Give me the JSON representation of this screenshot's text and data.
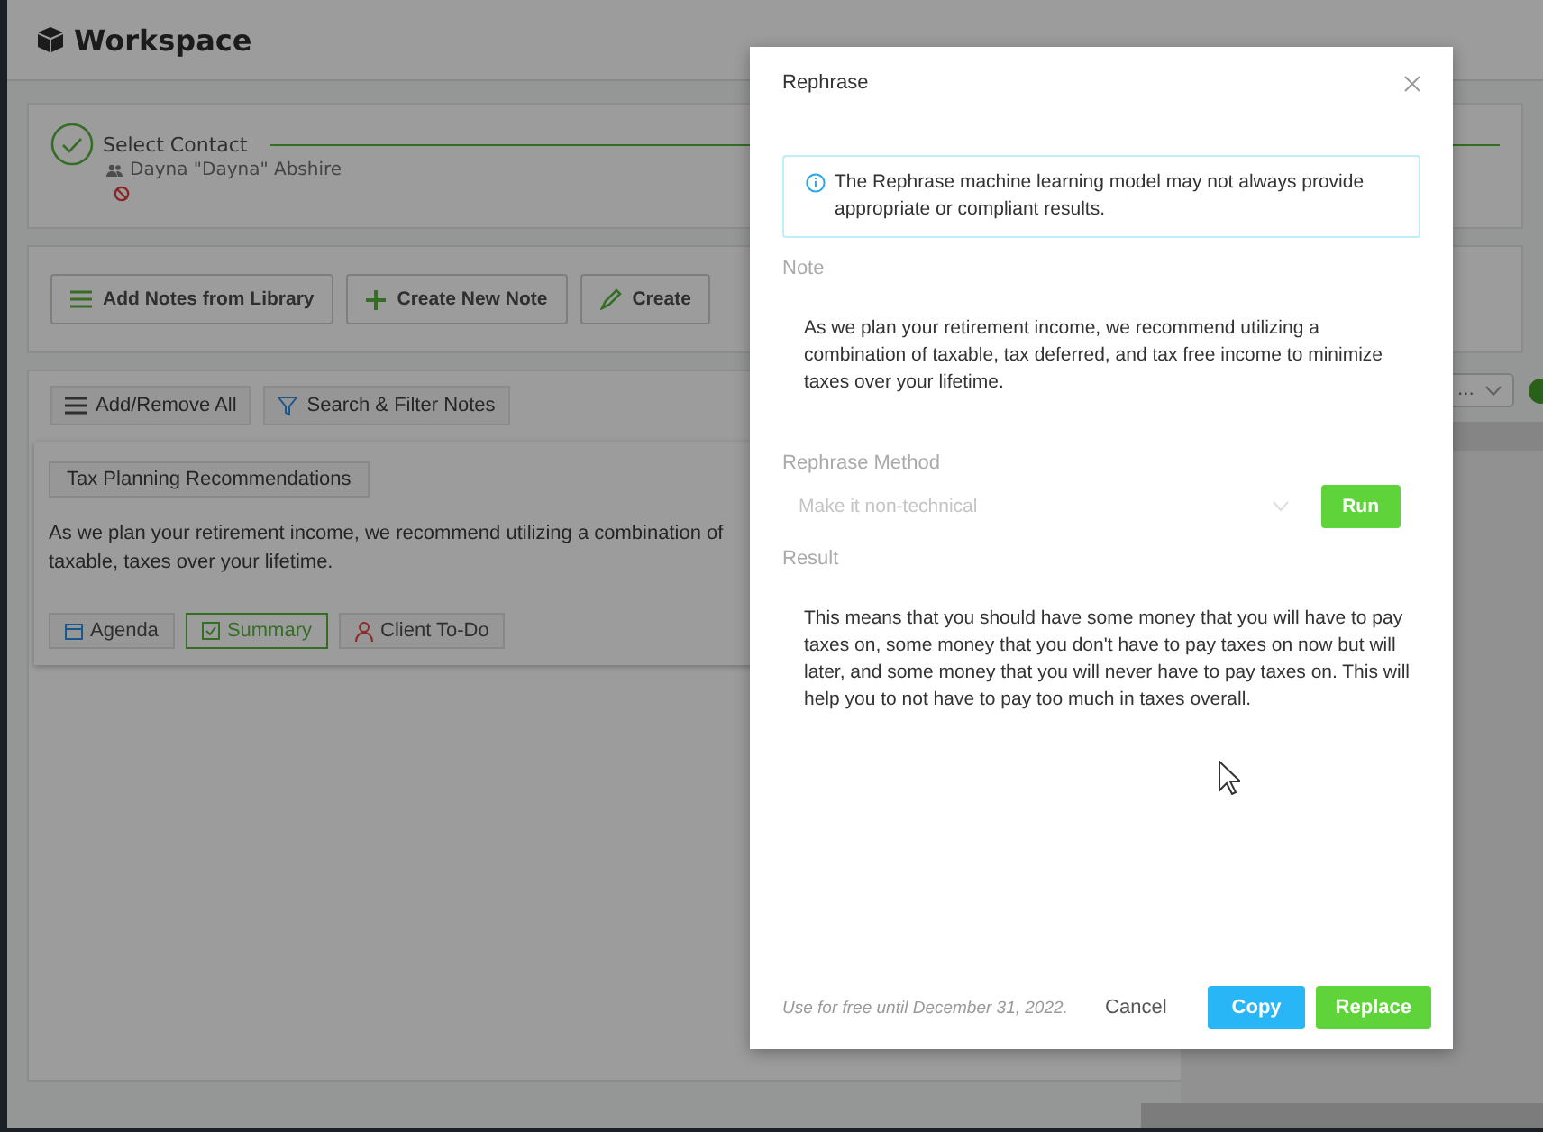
{
  "app": {
    "title": "Workspace"
  },
  "contact_step": {
    "label": "Select Contact",
    "completed": true,
    "contact_name": "Dayna \"Dayna\" Abshire"
  },
  "note_actions": [
    {
      "label": "Add Notes from Library",
      "kind": "library"
    },
    {
      "label": "Create New Note",
      "kind": "create"
    },
    {
      "label": "Create",
      "kind": "write"
    }
  ],
  "notes_toolbar": [
    {
      "label": "Add/Remove All",
      "kind": "menu"
    },
    {
      "label": "Search & Filter Notes",
      "kind": "filter"
    }
  ],
  "filter_dropdown": {
    "value": "..."
  },
  "note_card": {
    "title": "Tax Planning Recommendations",
    "text": "As we plan your retirement income, we recommend utilizing a combination of taxable, taxes over your lifetime.",
    "sections": [
      {
        "label": "Agenda",
        "kind": "agenda",
        "selected": false
      },
      {
        "label": "Summary",
        "kind": "summary",
        "selected": true
      },
      {
        "label": "Client To-Do",
        "kind": "todo",
        "selected": false
      }
    ]
  },
  "dialog": {
    "title": "Rephrase",
    "notice": "The Rephrase machine learning model may not always provide appropriate or compliant results.",
    "note_label": "Note",
    "note_text": "As we plan your retirement income, we recommend utilizing a combination of taxable, tax deferred, and tax free income to minimize taxes over your lifetime.",
    "method_label": "Rephrase Method",
    "method_value": "Make it non-technical",
    "run_button": "Run",
    "result_label": "Result",
    "result_text": "This means that you should have some money that you will have to pay taxes on, some money that you don't have to pay taxes on now but will later, and some money that you will never have to pay taxes on. This will help you to not have to pay too much in taxes overall.",
    "footer_note": "Use for free until December 31, 2022.",
    "buttons": [
      {
        "label": "Cancel",
        "kind": "plain"
      },
      {
        "label": "Copy",
        "kind": "copy"
      },
      {
        "label": "Replace",
        "kind": "replace"
      }
    ]
  }
}
